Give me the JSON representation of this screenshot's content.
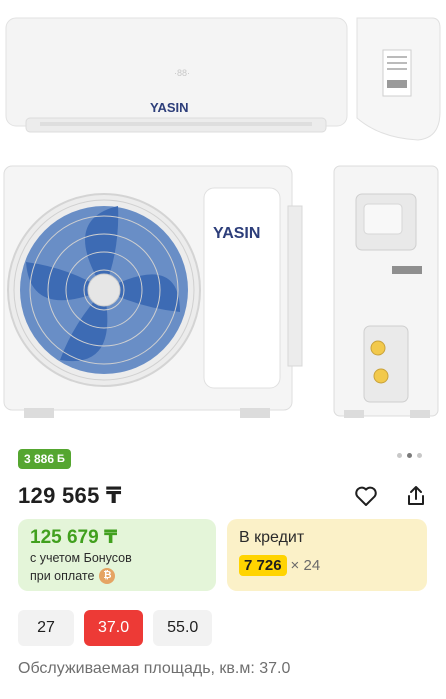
{
  "product_images": {
    "brand": "YASIN"
  },
  "gallery": {
    "dots": [
      "inactive",
      "active",
      "inactive"
    ]
  },
  "bonus_badge": {
    "amount": "3 886",
    "symbol": "Б"
  },
  "price": {
    "main": "129 565 ₸"
  },
  "bonus_card": {
    "price": "125 679 ₸",
    "line1": "с учетом Бонусов",
    "line2": "при оплате",
    "pay_icon": "₿"
  },
  "credit_card": {
    "title": "В кредит",
    "amount": "7 726",
    "multiplier": "× 24"
  },
  "options": [
    {
      "label": "27",
      "selected": false
    },
    {
      "label": "37.0",
      "selected": true
    },
    {
      "label": "55.0",
      "selected": false
    }
  ],
  "spec": {
    "text": "Обслуживаемая площадь, кв.м: 37.0"
  },
  "icons": {
    "favorite": "heart-icon",
    "share": "share-icon"
  },
  "colors": {
    "bonus_green": "#55a630",
    "price_green": "#41a01e",
    "selected_red": "#ed3a36",
    "credit_yellow": "#ffd400"
  }
}
